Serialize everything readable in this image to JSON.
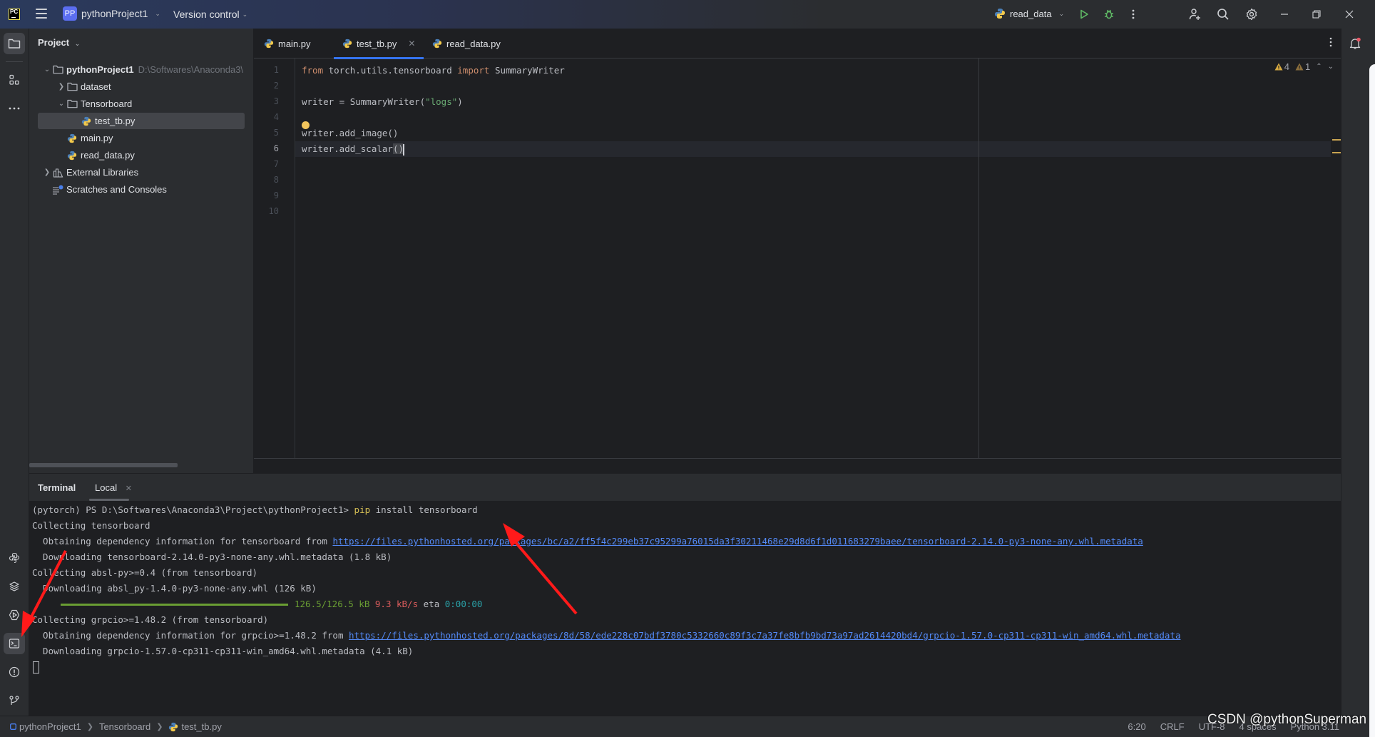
{
  "titlebar": {
    "logo_text": "PC",
    "project_badge": "PP",
    "project_name": "pythonProject1",
    "version_control": "Version control",
    "run_config": "read_data"
  },
  "left_strip": {
    "tools": [
      "project",
      "structure",
      "more",
      "python-console",
      "python-packages",
      "services",
      "terminal",
      "problems",
      "git"
    ],
    "active": "terminal"
  },
  "project_panel": {
    "title": "Project",
    "tree": [
      {
        "label": "pythonProject1",
        "path": "D:\\Softwares\\Anaconda3\\",
        "type": "folder",
        "expanded": true,
        "level": 0,
        "bold": true
      },
      {
        "label": "dataset",
        "type": "folder",
        "expanded": false,
        "level": 1
      },
      {
        "label": "Tensorboard",
        "type": "folder",
        "expanded": true,
        "level": 1
      },
      {
        "label": "test_tb.py",
        "type": "python",
        "level": 2,
        "selected": true
      },
      {
        "label": "main.py",
        "type": "python",
        "level": 1
      },
      {
        "label": "read_data.py",
        "type": "python",
        "level": 1
      },
      {
        "label": "External Libraries",
        "type": "libraries",
        "expanded": false,
        "level": 0
      },
      {
        "label": "Scratches and Consoles",
        "type": "scratches",
        "level": 0
      }
    ]
  },
  "editor": {
    "tabs": [
      {
        "label": "main.py",
        "active": false
      },
      {
        "label": "test_tb.py",
        "active": true,
        "closable": true
      },
      {
        "label": "read_data.py",
        "active": false
      }
    ],
    "inspections": {
      "warnings": "4",
      "weak_warnings": "1"
    },
    "current_line": 6,
    "lines": [
      {
        "n": "1",
        "parts": [
          {
            "t": "from",
            "c": "kw"
          },
          {
            "t": " torch.utils.tensorboard "
          },
          {
            "t": "import",
            "c": "kw"
          },
          {
            "t": " SummaryWriter"
          }
        ]
      },
      {
        "n": "2",
        "parts": []
      },
      {
        "n": "3",
        "parts": [
          {
            "t": "writer = SummaryWriter("
          },
          {
            "t": "\"logs\"",
            "c": "str"
          },
          {
            "t": ")"
          }
        ]
      },
      {
        "n": "4",
        "parts": []
      },
      {
        "n": "5",
        "parts": [
          {
            "t": "writer.add_image()"
          }
        ]
      },
      {
        "n": "6",
        "parts": [
          {
            "t": "writer.add_scalar"
          },
          {
            "t": "()",
            "c": "caret-paren"
          }
        ]
      },
      {
        "n": "7",
        "parts": []
      },
      {
        "n": "8",
        "parts": []
      },
      {
        "n": "9",
        "parts": []
      },
      {
        "n": "10",
        "parts": []
      }
    ]
  },
  "terminal": {
    "title": "Terminal",
    "tab_label": "Local",
    "prompt": "(pytorch) PS D:\\Softwares\\Anaconda3\\Project\\pythonProject1> ",
    "command_bin": "pip",
    "command_args": " install tensorboard",
    "output": {
      "l1": "Collecting tensorboard",
      "l2_prefix": "  Obtaining dependency information for tensorboard from ",
      "l2_link": "https://files.pythonhosted.org/packages/bc/a2/ff5f4c299eb37c95299a76015da3f30211468e29d8d6f1d011683279baee/tensorboard-2.14.0-py3-none-any.whl.metadata",
      "l3": "  Downloading tensorboard-2.14.0-py3-none-any.whl.metadata (1.8 kB)",
      "l4": "Collecting absl-py>=0.4 (from tensorboard)",
      "l5": "  Downloading absl_py-1.4.0-py3-none-any.whl (126 kB)",
      "progress_size": "126.5/126.5 kB",
      "progress_speed": "9.3 kB/s",
      "progress_eta_label": "eta",
      "progress_eta": "0:00:00",
      "progress_fraction": 1.0,
      "l7": "Collecting grpcio>=1.48.2 (from tensorboard)",
      "l8_prefix": "  Obtaining dependency information for grpcio>=1.48.2 from ",
      "l8_link": "https://files.pythonhosted.org/packages/8d/58/ede228c07bdf3780c5332660c89f3c7a37fe8bfb9bd73a97ad2614420bd4/grpcio-1.57.0-cp311-cp311-win_amd64.whl.metadata",
      "l9": "  Downloading grpcio-1.57.0-cp311-cp311-win_amd64.whl.metadata (4.1 kB)"
    }
  },
  "statusbar": {
    "breadcrumb": [
      "pythonProject1",
      "Tensorboard",
      "test_tb.py"
    ],
    "position": "6:20",
    "line_ending": "CRLF",
    "encoding": "UTF-8",
    "indent": "4 spaces",
    "interpreter": "Python 3.11"
  },
  "watermark": "CSDN @pythonSuperman",
  "colors": {
    "accent": "#3574f0",
    "keyword": "#cf8e6d",
    "string": "#6aab73",
    "link": "#548af7",
    "annotation_arrow": "#ff1a1a"
  }
}
